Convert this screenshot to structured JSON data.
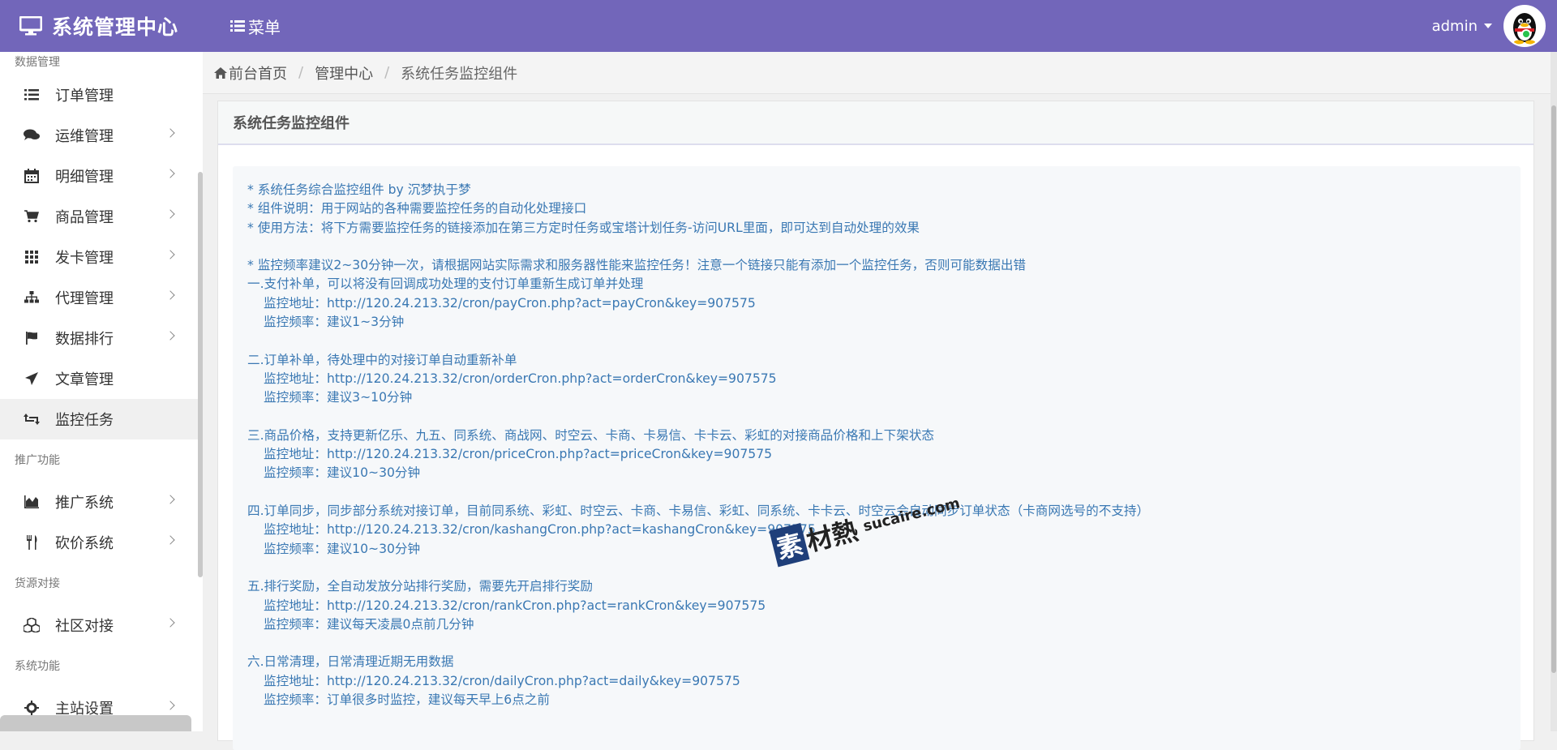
{
  "header": {
    "brand": "系统管理中心",
    "menu_label": "菜单",
    "user": "admin"
  },
  "sidebar": {
    "sections": [
      {
        "title": "数据管理"
      },
      {
        "title": "推广功能"
      },
      {
        "title": "货源对接"
      },
      {
        "title": "系统功能"
      }
    ],
    "items": [
      {
        "label": "订单管理",
        "icon": "list-icon"
      },
      {
        "label": "运维管理",
        "icon": "comments-icon"
      },
      {
        "label": "明细管理",
        "icon": "calendar-icon"
      },
      {
        "label": "商品管理",
        "icon": "cart-icon"
      },
      {
        "label": "发卡管理",
        "icon": "grid-icon"
      },
      {
        "label": "代理管理",
        "icon": "sitemap-icon"
      },
      {
        "label": "数据排行",
        "icon": "flag-icon"
      },
      {
        "label": "文章管理",
        "icon": "paper-plane-icon"
      },
      {
        "label": "监控任务",
        "icon": "retweet-icon"
      },
      {
        "label": "推广系统",
        "icon": "area-chart-icon"
      },
      {
        "label": "砍价系统",
        "icon": "cutlery-icon"
      },
      {
        "label": "社区对接",
        "icon": "cubes-icon"
      },
      {
        "label": "主站设置",
        "icon": "gear-icon"
      }
    ]
  },
  "breadcrumb": {
    "home": "前台首页",
    "center": "管理中心",
    "current": "系统任务监控组件"
  },
  "panel": {
    "title": "系统任务监控组件",
    "lines": [
      "* 系统任务综合监控组件 by 沉梦执于梦",
      "* 组件说明：用于网站的各种需要监控任务的自动化处理接口",
      "* 使用方法：将下方需要监控任务的链接添加在第三方定时任务或宝塔计划任务-访问URL里面，即可达到自动处理的效果",
      "",
      "* 监控频率建议2~30分钟一次，请根据网站实际需求和服务器性能来监控任务！注意一个链接只能有添加一个监控任务，否则可能数据出错",
      "一.支付补单，可以将没有回调成功处理的支付订单重新生成订单并处理",
      "监控地址：http://120.24.213.32/cron/payCron.php?act=payCron&key=907575",
      "监控频率：建议1~3分钟",
      "",
      "二.订单补单，待处理中的对接订单自动重新补单",
      "监控地址：http://120.24.213.32/cron/orderCron.php?act=orderCron&key=907575",
      "监控频率：建议3~10分钟",
      "",
      "三.商品价格，支持更新亿乐、九五、同系统、商战网、时空云、卡商、卡易信、卡卡云、彩虹的对接商品价格和上下架状态",
      "监控地址：http://120.24.213.32/cron/priceCron.php?act=priceCron&key=907575",
      "监控频率：建议10~30分钟",
      "",
      "四.订单同步，同步部分系统对接订单，目前同系统、彩虹、时空云、卡商、卡易信、彩虹、同系统、卡卡云、时空云会自动同步订单状态（卡商网选号的不支持）",
      "监控地址：http://120.24.213.32/cron/kashangCron.php?act=kashangCron&key=907575",
      "监控频率：建议10~30分钟",
      "",
      "五.排行奖励，全自动发放分站排行奖励，需要先开启排行奖励",
      "监控地址：http://120.24.213.32/cron/rankCron.php?act=rankCron&key=907575",
      "监控频率：建议每天凌晨0点前几分钟",
      "",
      "六.日常清理，日常清理近期无用数据",
      "监控地址：http://120.24.213.32/cron/dailyCron.php?act=daily&key=907575",
      "监控频率：订单很多时监控，建议每天早上6点之前"
    ]
  },
  "watermark": {
    "box": "素",
    "text": "材熱",
    "url": "sucaire.com"
  },
  "colors": {
    "header_bg": "#7266ba",
    "link_text": "#3a78b3"
  }
}
